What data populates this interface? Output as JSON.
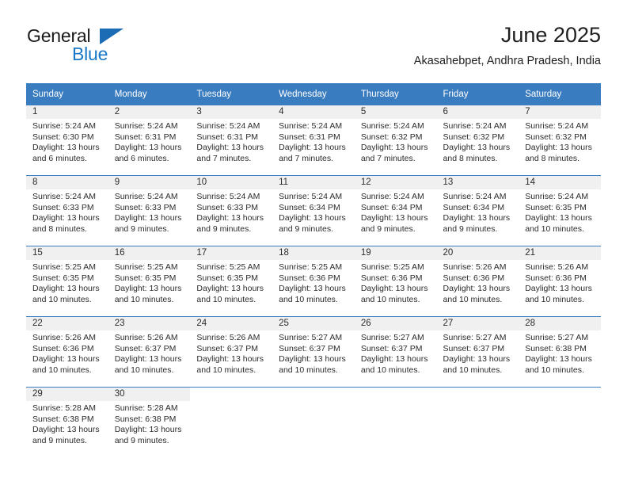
{
  "brand": {
    "word1": "General",
    "word2": "Blue",
    "triangle_color": "#1b6cb5",
    "word2_color": "#1878c8"
  },
  "header": {
    "title": "June 2025",
    "subtitle": "Akasahebpet, Andhra Pradesh, India"
  },
  "theme": {
    "header_bg": "#3a7cc0",
    "daynum_bg": "#f0f0f0",
    "row_divider": "#3a7cc0",
    "text": "#2b2b2b"
  },
  "calendar": {
    "weekday_headers": [
      "Sunday",
      "Monday",
      "Tuesday",
      "Wednesday",
      "Thursday",
      "Friday",
      "Saturday"
    ],
    "weeks": [
      [
        {
          "day": "1",
          "sunrise": "Sunrise: 5:24 AM",
          "sunset": "Sunset: 6:30 PM",
          "daylight_1": "Daylight: 13 hours",
          "daylight_2": "and 6 minutes."
        },
        {
          "day": "2",
          "sunrise": "Sunrise: 5:24 AM",
          "sunset": "Sunset: 6:31 PM",
          "daylight_1": "Daylight: 13 hours",
          "daylight_2": "and 6 minutes."
        },
        {
          "day": "3",
          "sunrise": "Sunrise: 5:24 AM",
          "sunset": "Sunset: 6:31 PM",
          "daylight_1": "Daylight: 13 hours",
          "daylight_2": "and 7 minutes."
        },
        {
          "day": "4",
          "sunrise": "Sunrise: 5:24 AM",
          "sunset": "Sunset: 6:31 PM",
          "daylight_1": "Daylight: 13 hours",
          "daylight_2": "and 7 minutes."
        },
        {
          "day": "5",
          "sunrise": "Sunrise: 5:24 AM",
          "sunset": "Sunset: 6:32 PM",
          "daylight_1": "Daylight: 13 hours",
          "daylight_2": "and 7 minutes."
        },
        {
          "day": "6",
          "sunrise": "Sunrise: 5:24 AM",
          "sunset": "Sunset: 6:32 PM",
          "daylight_1": "Daylight: 13 hours",
          "daylight_2": "and 8 minutes."
        },
        {
          "day": "7",
          "sunrise": "Sunrise: 5:24 AM",
          "sunset": "Sunset: 6:32 PM",
          "daylight_1": "Daylight: 13 hours",
          "daylight_2": "and 8 minutes."
        }
      ],
      [
        {
          "day": "8",
          "sunrise": "Sunrise: 5:24 AM",
          "sunset": "Sunset: 6:33 PM",
          "daylight_1": "Daylight: 13 hours",
          "daylight_2": "and 8 minutes."
        },
        {
          "day": "9",
          "sunrise": "Sunrise: 5:24 AM",
          "sunset": "Sunset: 6:33 PM",
          "daylight_1": "Daylight: 13 hours",
          "daylight_2": "and 9 minutes."
        },
        {
          "day": "10",
          "sunrise": "Sunrise: 5:24 AM",
          "sunset": "Sunset: 6:33 PM",
          "daylight_1": "Daylight: 13 hours",
          "daylight_2": "and 9 minutes."
        },
        {
          "day": "11",
          "sunrise": "Sunrise: 5:24 AM",
          "sunset": "Sunset: 6:34 PM",
          "daylight_1": "Daylight: 13 hours",
          "daylight_2": "and 9 minutes."
        },
        {
          "day": "12",
          "sunrise": "Sunrise: 5:24 AM",
          "sunset": "Sunset: 6:34 PM",
          "daylight_1": "Daylight: 13 hours",
          "daylight_2": "and 9 minutes."
        },
        {
          "day": "13",
          "sunrise": "Sunrise: 5:24 AM",
          "sunset": "Sunset: 6:34 PM",
          "daylight_1": "Daylight: 13 hours",
          "daylight_2": "and 9 minutes."
        },
        {
          "day": "14",
          "sunrise": "Sunrise: 5:24 AM",
          "sunset": "Sunset: 6:35 PM",
          "daylight_1": "Daylight: 13 hours",
          "daylight_2": "and 10 minutes."
        }
      ],
      [
        {
          "day": "15",
          "sunrise": "Sunrise: 5:25 AM",
          "sunset": "Sunset: 6:35 PM",
          "daylight_1": "Daylight: 13 hours",
          "daylight_2": "and 10 minutes."
        },
        {
          "day": "16",
          "sunrise": "Sunrise: 5:25 AM",
          "sunset": "Sunset: 6:35 PM",
          "daylight_1": "Daylight: 13 hours",
          "daylight_2": "and 10 minutes."
        },
        {
          "day": "17",
          "sunrise": "Sunrise: 5:25 AM",
          "sunset": "Sunset: 6:35 PM",
          "daylight_1": "Daylight: 13 hours",
          "daylight_2": "and 10 minutes."
        },
        {
          "day": "18",
          "sunrise": "Sunrise: 5:25 AM",
          "sunset": "Sunset: 6:36 PM",
          "daylight_1": "Daylight: 13 hours",
          "daylight_2": "and 10 minutes."
        },
        {
          "day": "19",
          "sunrise": "Sunrise: 5:25 AM",
          "sunset": "Sunset: 6:36 PM",
          "daylight_1": "Daylight: 13 hours",
          "daylight_2": "and 10 minutes."
        },
        {
          "day": "20",
          "sunrise": "Sunrise: 5:26 AM",
          "sunset": "Sunset: 6:36 PM",
          "daylight_1": "Daylight: 13 hours",
          "daylight_2": "and 10 minutes."
        },
        {
          "day": "21",
          "sunrise": "Sunrise: 5:26 AM",
          "sunset": "Sunset: 6:36 PM",
          "daylight_1": "Daylight: 13 hours",
          "daylight_2": "and 10 minutes."
        }
      ],
      [
        {
          "day": "22",
          "sunrise": "Sunrise: 5:26 AM",
          "sunset": "Sunset: 6:36 PM",
          "daylight_1": "Daylight: 13 hours",
          "daylight_2": "and 10 minutes."
        },
        {
          "day": "23",
          "sunrise": "Sunrise: 5:26 AM",
          "sunset": "Sunset: 6:37 PM",
          "daylight_1": "Daylight: 13 hours",
          "daylight_2": "and 10 minutes."
        },
        {
          "day": "24",
          "sunrise": "Sunrise: 5:26 AM",
          "sunset": "Sunset: 6:37 PM",
          "daylight_1": "Daylight: 13 hours",
          "daylight_2": "and 10 minutes."
        },
        {
          "day": "25",
          "sunrise": "Sunrise: 5:27 AM",
          "sunset": "Sunset: 6:37 PM",
          "daylight_1": "Daylight: 13 hours",
          "daylight_2": "and 10 minutes."
        },
        {
          "day": "26",
          "sunrise": "Sunrise: 5:27 AM",
          "sunset": "Sunset: 6:37 PM",
          "daylight_1": "Daylight: 13 hours",
          "daylight_2": "and 10 minutes."
        },
        {
          "day": "27",
          "sunrise": "Sunrise: 5:27 AM",
          "sunset": "Sunset: 6:37 PM",
          "daylight_1": "Daylight: 13 hours",
          "daylight_2": "and 10 minutes."
        },
        {
          "day": "28",
          "sunrise": "Sunrise: 5:27 AM",
          "sunset": "Sunset: 6:38 PM",
          "daylight_1": "Daylight: 13 hours",
          "daylight_2": "and 10 minutes."
        }
      ],
      [
        {
          "day": "29",
          "sunrise": "Sunrise: 5:28 AM",
          "sunset": "Sunset: 6:38 PM",
          "daylight_1": "Daylight: 13 hours",
          "daylight_2": "and 9 minutes."
        },
        {
          "day": "30",
          "sunrise": "Sunrise: 5:28 AM",
          "sunset": "Sunset: 6:38 PM",
          "daylight_1": "Daylight: 13 hours",
          "daylight_2": "and 9 minutes."
        },
        {
          "day": "",
          "sunrise": "",
          "sunset": "",
          "daylight_1": "",
          "daylight_2": ""
        },
        {
          "day": "",
          "sunrise": "",
          "sunset": "",
          "daylight_1": "",
          "daylight_2": ""
        },
        {
          "day": "",
          "sunrise": "",
          "sunset": "",
          "daylight_1": "",
          "daylight_2": ""
        },
        {
          "day": "",
          "sunrise": "",
          "sunset": "",
          "daylight_1": "",
          "daylight_2": ""
        },
        {
          "day": "",
          "sunrise": "",
          "sunset": "",
          "daylight_1": "",
          "daylight_2": ""
        }
      ]
    ]
  }
}
